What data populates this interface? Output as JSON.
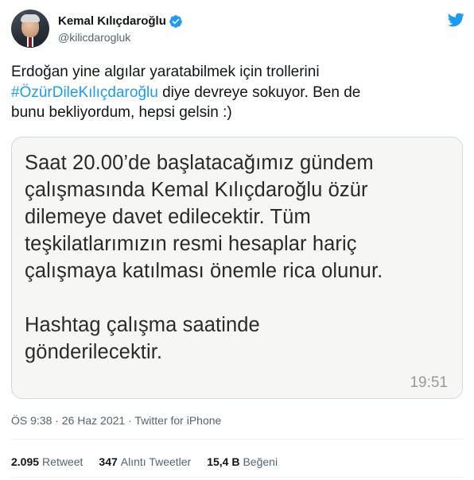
{
  "author": {
    "display_name": "Kemal Kılıçdaroğlu",
    "handle": "@kilicdarogluk",
    "verified": true,
    "avatar_icon": "profile-photo"
  },
  "tweet": {
    "text_line1": "Erdoğan yine algılar yaratabilmek için trollerini",
    "hashtag": "#ÖzürDileKılıçdaroğlu",
    "text_after_hashtag": " diye devreye sokuyor. Ben de",
    "text_line3": "bunu bekliyordum, hepsi gelsin :)"
  },
  "media": {
    "message_lines": [
      "Saat 20.00’de başlatacağımız gündem",
      "çalışmasında Kemal Kılıçdaroğlu özür",
      "dilemeye davet edilecektir.  Tüm",
      "teşkilatlarımızın resmi hesaplar hariç",
      "çalışmaya katılması önemle rica olunur."
    ],
    "message_lines_2": [
      "Hashtag çalışma saatinde",
      "gönderilecektir."
    ],
    "message_time": "19:51"
  },
  "meta": {
    "line": "ÖS 9:38 · 26 Haz 2021 · Twitter for iPhone"
  },
  "stats": {
    "retweets_count": "2.095",
    "retweets_label": "Retweet",
    "quotes_count": "347",
    "quotes_label": "Alıntı Tweetler",
    "likes_count": "15,4 B",
    "likes_label": "Beğeni"
  },
  "colors": {
    "accent": "#1d9bf0",
    "text": "#0f1419",
    "secondary": "#536471"
  }
}
